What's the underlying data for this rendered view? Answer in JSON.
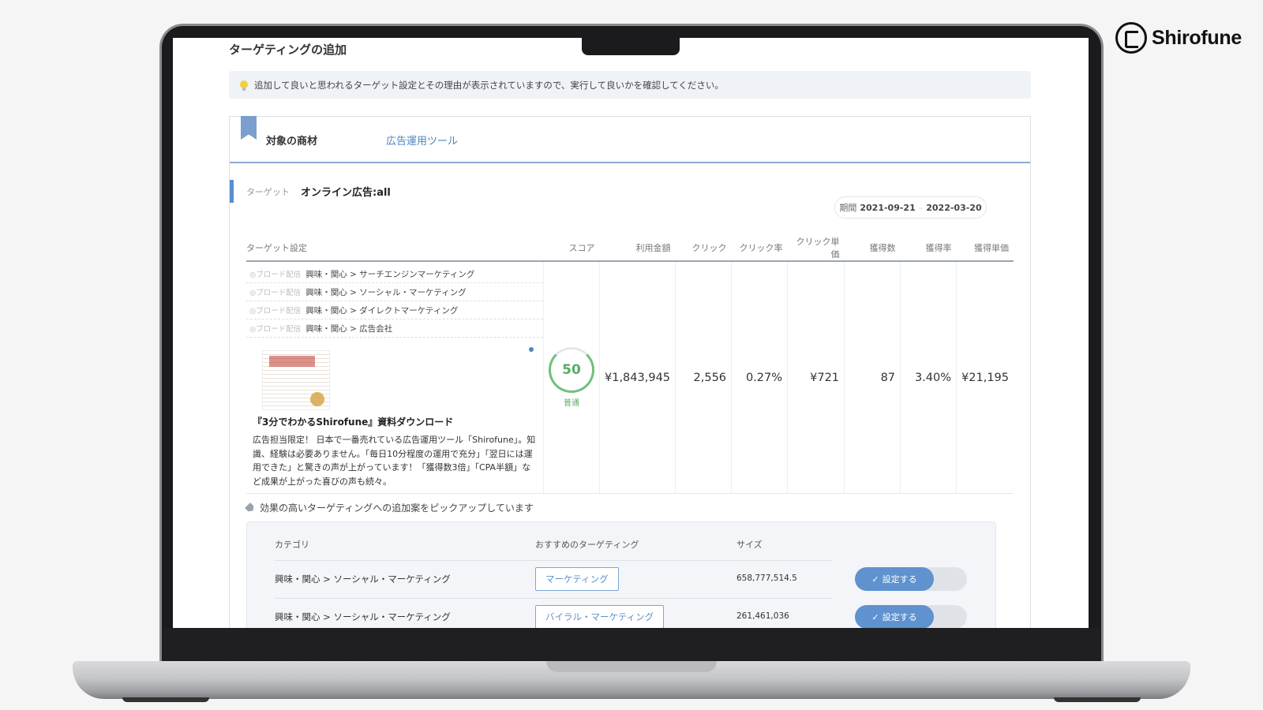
{
  "brand": {
    "name": "Shirofune"
  },
  "page": {
    "title": "ターゲティングの追加",
    "hint": "追加して良いと思われるターゲット設定とその理由が表示されていますので、実行して良いかを確認してください。"
  },
  "tabs": {
    "product": "対象の商材",
    "tool": "広告運用ツール"
  },
  "target": {
    "label": "ターゲット",
    "value": "オンライン広告:all"
  },
  "period": {
    "label": "期間",
    "start": "2021-09-21",
    "sep": "–",
    "end": "2022-03-20"
  },
  "table": {
    "headers": [
      "ターゲット設定",
      "スコア",
      "利用金額",
      "クリック",
      "クリック率",
      "クリック単価",
      "獲得数",
      "獲得率",
      "獲得単価"
    ],
    "segments": [
      {
        "tag": "◎ブロード配信",
        "text": "興味・関心 > サーチエンジンマーケティング"
      },
      {
        "tag": "◎ブロード配信",
        "text": "興味・関心 > ソーシャル・マーケティング"
      },
      {
        "tag": "◎ブロード配信",
        "text": "興味・関心 > ダイレクトマーケティング"
      },
      {
        "tag": "◎ブロード配信",
        "text": "興味・関心 > 広告会社"
      }
    ],
    "ad": {
      "title": "『3分でわかるShirofune』資料ダウンロード",
      "description": "広告担当限定！ 日本で一番売れている広告運用ツール「Shirofune」。知識、経験は必要ありません。「毎日10分程度の運用で充分」「翌日には運用できた」と驚きの声が上がっています！「獲得数3倍」「CPA半額」など成果が上がった喜びの声も続々。"
    },
    "score": {
      "value": "50",
      "label": "普通"
    },
    "values": {
      "spend": "¥1,843,945",
      "clicks": "2,556",
      "ctr": "0.27%",
      "cpc": "¥721",
      "conversions": "87",
      "cvr": "3.40%",
      "cpa": "¥21,195"
    }
  },
  "pickup": {
    "text": "効果の高いターゲティングへの追加案をピックアップしています"
  },
  "recommendations": {
    "headers": {
      "category": "カテゴリ",
      "targeting": "おすすめのターゲティング",
      "size": "サイズ"
    },
    "rows": [
      {
        "category": "興味・関心 > ソーシャル・マーケティング",
        "keyword": "マーケティング",
        "size": "658,777,514.5",
        "action": "設定する"
      },
      {
        "category": "興味・関心 > ソーシャル・マーケティング",
        "keyword": "バイラル・マーケティング",
        "size": "261,461,036",
        "action": "設定する"
      }
    ]
  }
}
